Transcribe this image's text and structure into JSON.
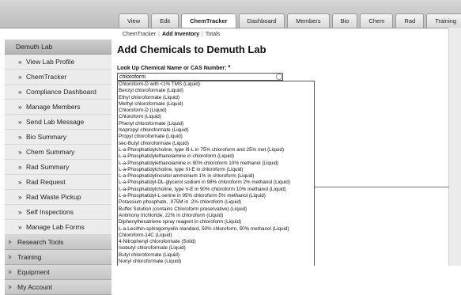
{
  "tabs": [
    {
      "label": "View",
      "active": false
    },
    {
      "label": "Edit",
      "active": false
    },
    {
      "label": "ChemTracker",
      "active": true
    },
    {
      "label": "Dashboard",
      "active": false
    },
    {
      "label": "Members",
      "active": false
    },
    {
      "label": "Bio",
      "active": false
    },
    {
      "label": "Chem",
      "active": false
    },
    {
      "label": "Rad",
      "active": false
    },
    {
      "label": "Training",
      "active": false
    }
  ],
  "breadcrumb": {
    "item1": "ChemTracker",
    "separator": "|",
    "current": "Add Inventory",
    "separator2": "|",
    "item3": "Totals"
  },
  "sidebar": {
    "lab_heading": "Demuth Lab",
    "bullet": "»",
    "items": [
      "View Lab Profile",
      "ChemTracker",
      "Compliance Dashboard",
      "Manage Members",
      "Send Lab Message",
      "Bio Summary",
      "Chem Summary",
      "Rad Summary",
      "Rad Request",
      "Rad Waste Pickup",
      "Self Inspections",
      "Manage Lab Forms"
    ],
    "sections": [
      "Research Tools",
      "Training",
      "Equipment",
      "My Account"
    ]
  },
  "main": {
    "title": "Add Chemicals to Demuth Lab",
    "field_label": "Look Up Chemical Name or CAS Number:",
    "required_marker": "*",
    "search_value": "chloroform",
    "results": [
      "Chloroform-D with <1% TMS (Liquid)",
      "Benzyl chloroformate (Liquid)",
      "Ethyl chloroformate (Liquid)",
      "Methyl chloroformate (Liquid)",
      "Chloroform-D (Liquid)",
      "Chloroform (Liquid)",
      "Phenyl chloroformate (Liquid)",
      "Isopropyl chloroformate (Liquid)",
      "Propyl chloroformate (Liquid)",
      "sec-Butyl chloroformate (Liquid)",
      "L-a-Phosphatidylcholine, type III-L in 75% chloroform and 25% met (Liquid)",
      "L-a-Phosphatidylethanolamine in chloroform (Liquid)",
      "L-a-Phosphatidylethanolamine in 90% chloroform 10% methanol (Liquid)",
      "L-a-Phosphatidylcholine, type XI-E in chloroform (Liquid)",
      "L-a-Phosphatidylinositol ammonium 1% in chloroform (Liquid)",
      "L-a-Phosphatidyl-DL-glycerol sodium in 98% chloroform 2% methanol (Liquid)",
      "L-a-Phosphatidylcholine, type V-E in 90% chloroform 10% methanol (Liquid)",
      "L-a-Phosphatidyl-L-serine in 95% chloroform 5% methanol (Liquid)",
      "Potassium phosphate, .075M in .2% chloroform (Liquid)",
      "Buffer Solution (contains Chloroform preservative) (Liquid)",
      "Antimony trichloride, 22% in chloroform (Liquid)",
      "Diphenylhexatriene spray reagent in chloroform (Liquid)",
      "L-a-Lecithin-sphingomyelin standard, 50% chloroform, 50% methanol (Liquid)",
      "Chloroform-14C (Liquid)",
      "4-Nitrophenyl chloroformate (Solid)",
      "Isobutyl chloroformate (Liquid)",
      "Butyl chloroformate (Liquid)",
      "Nonyl chloroformate (Liquid)"
    ]
  }
}
